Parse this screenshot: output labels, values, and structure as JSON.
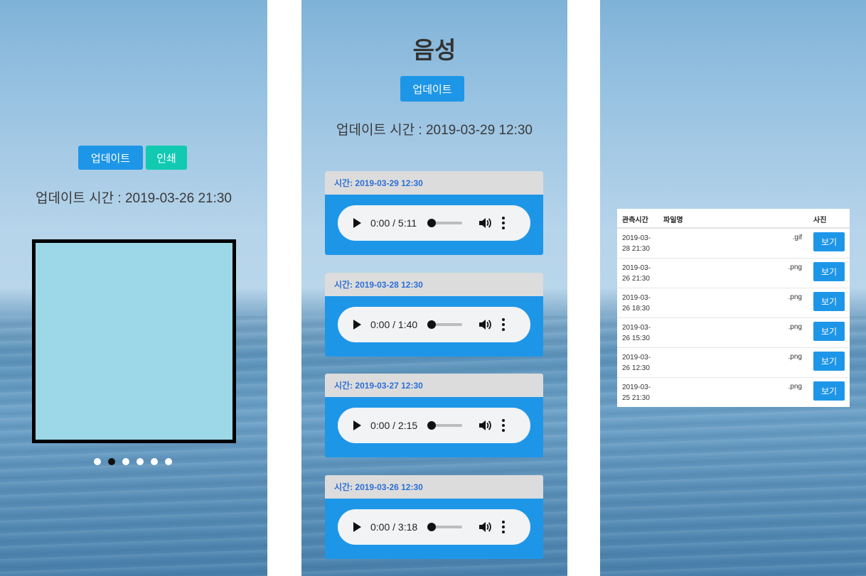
{
  "panel1": {
    "update_button": "업데이트",
    "print_button": "인쇄",
    "update_time": "업데이트 시간 : 2019-03-26 21:30",
    "carousel": {
      "count": 6,
      "active_index": 1
    }
  },
  "panel2": {
    "title": "음성",
    "update_button": "업데이트",
    "update_time": "업데이트 시간 : 2019-03-29 12:30",
    "recordings": [
      {
        "header": "시간: 2019-03-29 12:30",
        "time": "0:00 / 5:11"
      },
      {
        "header": "시간: 2019-03-28 12:30",
        "time": "0:00 / 1:40"
      },
      {
        "header": "시간: 2019-03-27 12:30",
        "time": "0:00 / 2:15"
      },
      {
        "header": "시간: 2019-03-26 12:30",
        "time": "0:00 / 3:18"
      }
    ]
  },
  "panel3": {
    "columns": {
      "time": "관측시간",
      "file": "파일명",
      "photo": "사진"
    },
    "rows": [
      {
        "date": "2019-03-28 21:30",
        "file": ".gif",
        "button": "보기"
      },
      {
        "date": "2019-03-26 21:30",
        "file": ".png",
        "button": "보기"
      },
      {
        "date": "2019-03-26 18:30",
        "file": ".png",
        "button": "보기"
      },
      {
        "date": "2019-03-26 15:30",
        "file": ".png",
        "button": "보기"
      },
      {
        "date": "2019-03-26 12:30",
        "file": ".png",
        "button": "보기"
      },
      {
        "date": "2019-03-25 21:30",
        "file": ".png",
        "button": "보기"
      }
    ]
  },
  "colors": {
    "accent": "#1e96e8",
    "teal": "#12c9b2",
    "header_link": "#2c6fd6"
  }
}
